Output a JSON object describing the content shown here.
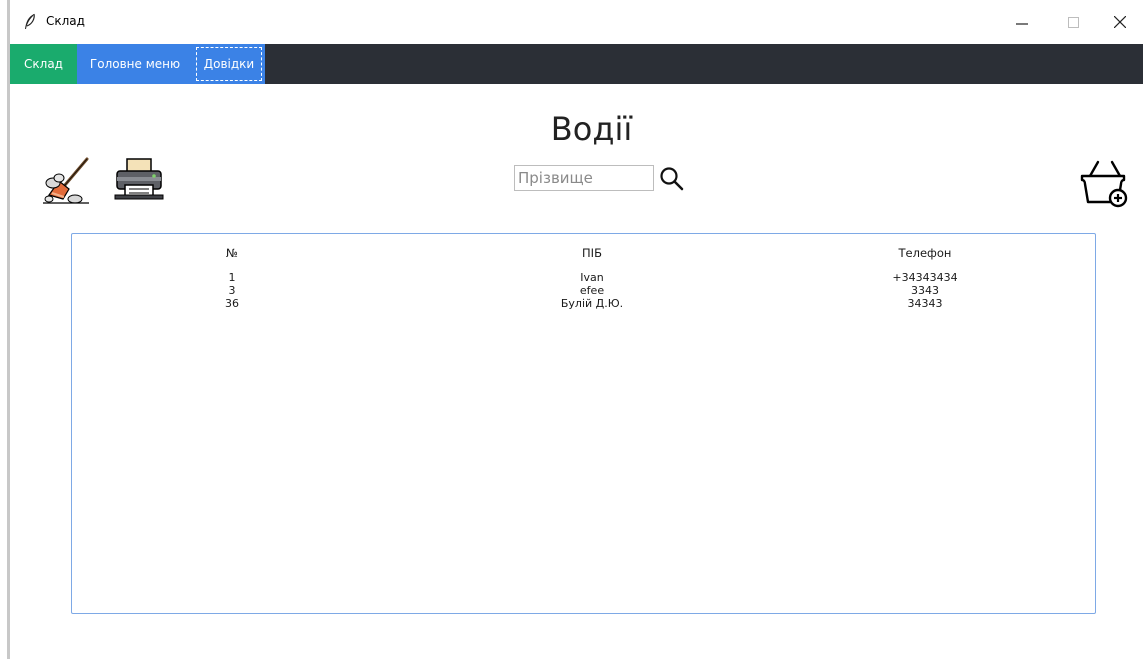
{
  "window": {
    "title": "Склад"
  },
  "menu": {
    "items": [
      {
        "label": "Склад"
      },
      {
        "label": "Головне меню"
      },
      {
        "label": "Довідки"
      }
    ]
  },
  "page": {
    "title": "Водії"
  },
  "search": {
    "placeholder": "Прізвище",
    "value": ""
  },
  "icons": {
    "clear": "broom-icon",
    "print": "printer-icon",
    "add": "basket-add-icon",
    "search": "search-icon"
  },
  "table": {
    "columns": [
      "№",
      "ПІБ",
      "Телефон"
    ],
    "rows": [
      {
        "no": "1",
        "name": "Ivan",
        "phone": "+34343434"
      },
      {
        "no": "3",
        "name": "efee",
        "phone": "3343"
      },
      {
        "no": "36",
        "name": "Булій Д.Ю.",
        "phone": "34343"
      }
    ]
  },
  "colors": {
    "menubar": "#2b2f36",
    "menu_active": "#1aab6d",
    "menu_button": "#3b82e6",
    "table_border": "#7ea9e6"
  }
}
